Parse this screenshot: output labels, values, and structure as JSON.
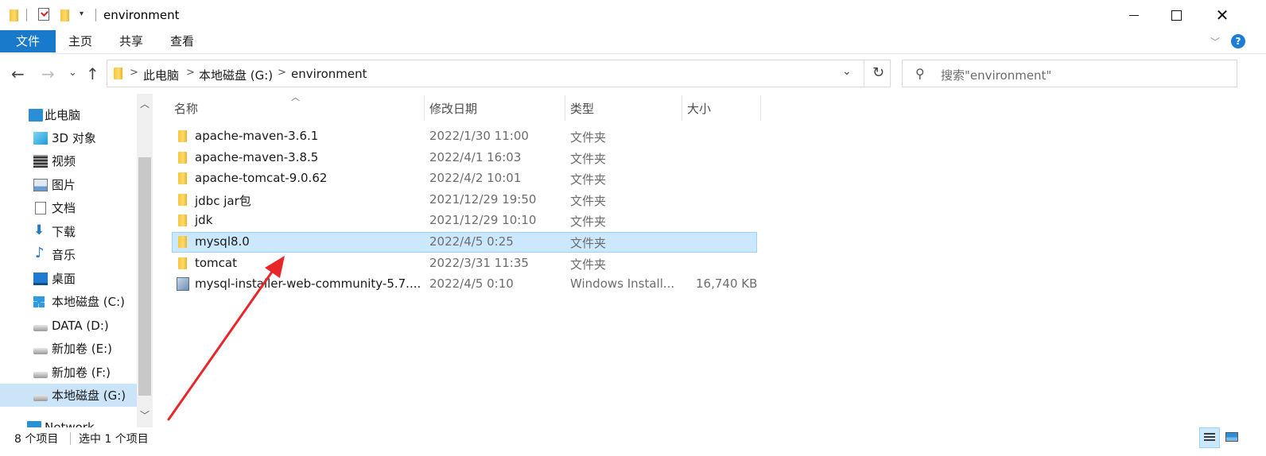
{
  "window": {
    "title": "environment",
    "min_icon": "minimize-icon",
    "max_icon": "maximize-icon",
    "close_icon": "close-icon"
  },
  "ribbon": {
    "tabs": [
      "文件",
      "主页",
      "共享",
      "查看"
    ],
    "accent": "#1979ca"
  },
  "nav": {
    "back_icon": "back-arrow-icon",
    "forward_icon": "forward-arrow-icon",
    "recent_icon": "chevron-down-icon",
    "up_icon": "up-arrow-icon",
    "breadcrumb": [
      "此电脑",
      "本地磁盘 (G:)",
      "environment"
    ],
    "search_placeholder": "搜索\"environment\""
  },
  "sidebar": {
    "items": [
      {
        "label": "此电脑",
        "icon": "computer-icon"
      },
      {
        "label": "3D 对象",
        "icon": "3d-objects-icon"
      },
      {
        "label": "视频",
        "icon": "video-icon"
      },
      {
        "label": "图片",
        "icon": "pictures-icon"
      },
      {
        "label": "文档",
        "icon": "documents-icon"
      },
      {
        "label": "下载",
        "icon": "download-icon"
      },
      {
        "label": "音乐",
        "icon": "music-icon"
      },
      {
        "label": "桌面",
        "icon": "desktop-icon"
      },
      {
        "label": "本地磁盘 (C:)",
        "icon": "windows-drive-icon"
      },
      {
        "label": "DATA (D:)",
        "icon": "drive-icon"
      },
      {
        "label": "新加卷 (E:)",
        "icon": "drive-icon"
      },
      {
        "label": "新加卷 (F:)",
        "icon": "drive-icon"
      },
      {
        "label": "本地磁盘 (G:)",
        "icon": "drive-icon"
      },
      {
        "label": "Network",
        "icon": "network-icon"
      }
    ],
    "selected_index": 12
  },
  "columns": [
    "名称",
    "修改日期",
    "类型",
    "大小"
  ],
  "files": [
    {
      "name": "apache-maven-3.6.1",
      "date": "2022/1/30 11:00",
      "type": "文件夹",
      "size": ""
    },
    {
      "name": "apache-maven-3.8.5",
      "date": "2022/4/1 16:03",
      "type": "文件夹",
      "size": ""
    },
    {
      "name": "apache-tomcat-9.0.62",
      "date": "2022/4/2 10:01",
      "type": "文件夹",
      "size": ""
    },
    {
      "name": "jdbc jar包",
      "date": "2021/12/29 19:50",
      "type": "文件夹",
      "size": ""
    },
    {
      "name": "jdk",
      "date": "2021/12/29 10:10",
      "type": "文件夹",
      "size": ""
    },
    {
      "name": "mysql8.0",
      "date": "2022/4/5 0:25",
      "type": "文件夹",
      "size": ""
    },
    {
      "name": "tomcat",
      "date": "2022/3/31 11:35",
      "type": "文件夹",
      "size": ""
    },
    {
      "name": "mysql-installer-web-community-5.7....",
      "date": "2022/4/5 0:10",
      "type": "Windows Install...",
      "size": "16,740 KB"
    }
  ],
  "selected_file_index": 5,
  "status": {
    "count": "8 个项目",
    "selection": "选中 1 个项目"
  },
  "annotation_color": "#e8262a"
}
